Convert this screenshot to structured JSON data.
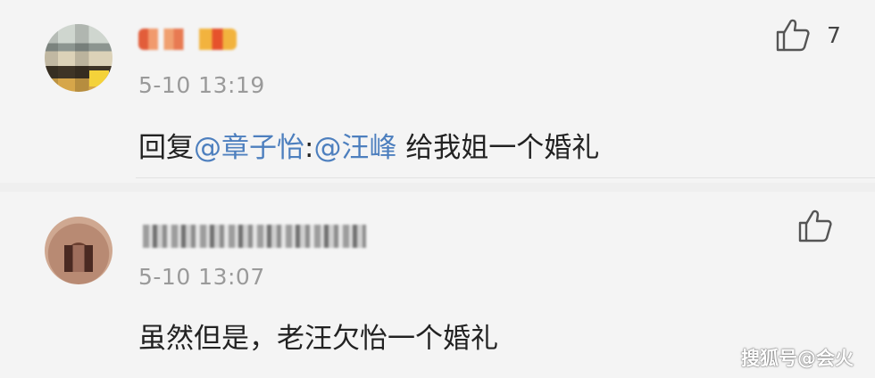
{
  "comments": [
    {
      "timestamp": "5-10 13:19",
      "content": {
        "prefix": "回复",
        "mention1": "@章子怡",
        "separator": ":",
        "mention2": "@汪峰",
        "text": " 给我姐一个婚礼"
      },
      "likes": "7",
      "like_icon": "thumbs-up-icon"
    },
    {
      "timestamp": "5-10 13:07",
      "content": {
        "text": "虽然但是，老汪欠怡一个婚礼"
      },
      "like_icon": "thumbs-up-icon"
    }
  ],
  "watermark": "搜狐号@会火",
  "colors": {
    "background": "#f4f4f4",
    "mention": "#4d7fbe",
    "text": "#222222",
    "timestamp": "#9a9a9a"
  }
}
